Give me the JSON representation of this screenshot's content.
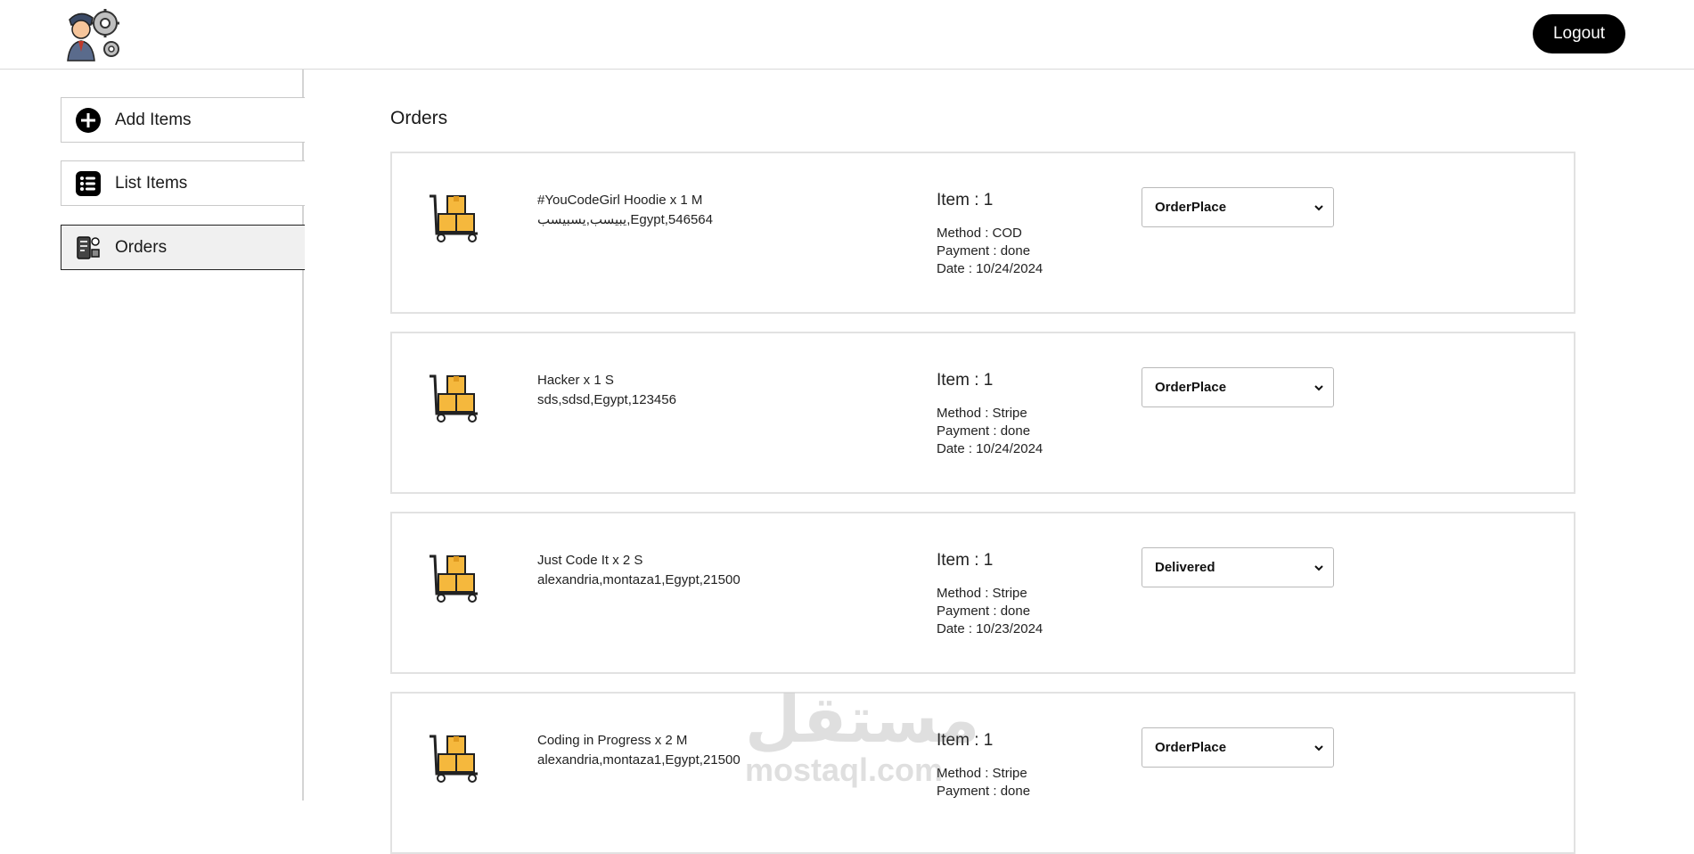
{
  "header": {
    "logo_icon": "admin-avatar-with-gears",
    "logout_label": "Logout"
  },
  "sidebar": {
    "items": [
      {
        "label": "Add Items",
        "icon": "plus-circle-icon"
      },
      {
        "label": "List Items",
        "icon": "list-icon"
      },
      {
        "label": "Orders",
        "icon": "orders-icon",
        "active": true
      }
    ]
  },
  "main": {
    "title": "Orders",
    "orders": [
      {
        "items": "#YouCodeGirl Hoodie x 1 M",
        "address": "يبيسب,يسبيسب,Egypt,546564",
        "count": "Item : 1",
        "method": "Method : COD",
        "payment": "Payment : done",
        "date": "Date : 10/24/2024",
        "status": "OrderPlace"
      },
      {
        "items": "Hacker x 1 S",
        "address": "sds,sdsd,Egypt,123456",
        "count": "Item : 1",
        "method": "Method : Stripe",
        "payment": "Payment : done",
        "date": "Date : 10/24/2024",
        "status": "OrderPlace"
      },
      {
        "items": "Just Code It x 2 S",
        "address": "alexandria,montaza1,Egypt,21500",
        "count": "Item : 1",
        "method": "Method : Stripe",
        "payment": "Payment : done",
        "date": "Date : 10/23/2024",
        "status": "Delivered"
      },
      {
        "items": "Coding in Progress x 2 M",
        "address": "alexandria,montaza1,Egypt,21500",
        "count": "Item : 1",
        "method": "Method : Stripe",
        "payment": "Payment : done",
        "date": "",
        "status": "OrderPlace"
      }
    ]
  },
  "watermark": {
    "arabic": "مستقل",
    "latin": "mostaql.com"
  },
  "colors": {
    "accent": "#000000",
    "parcel_box": "#F5B83D",
    "border": "#e2e2e2"
  }
}
